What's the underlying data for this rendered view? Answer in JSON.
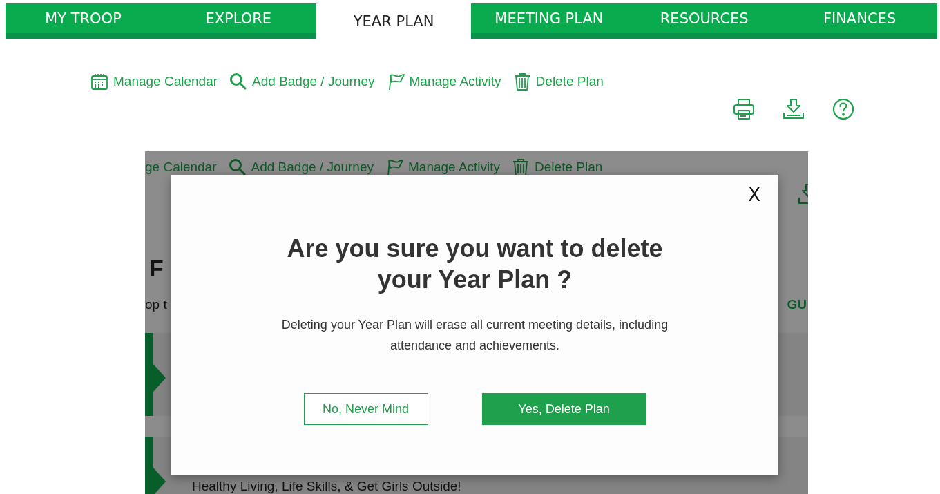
{
  "nav": {
    "tabs": [
      {
        "label": "MY TROOP",
        "selected": false
      },
      {
        "label": "EXPLORE",
        "selected": false
      },
      {
        "label": "YEAR PLAN",
        "selected": true
      },
      {
        "label": "MEETING PLAN",
        "selected": false
      },
      {
        "label": "RESOURCES",
        "selected": false
      },
      {
        "label": "FINANCES",
        "selected": false
      }
    ]
  },
  "toolbar": {
    "actions": [
      {
        "kind": "calendar",
        "label": "Manage Calendar"
      },
      {
        "kind": "search",
        "label": "Add Badge / Journey"
      },
      {
        "kind": "flag",
        "label": "Manage Activity"
      },
      {
        "kind": "trash",
        "label": "Delete Plan"
      }
    ]
  },
  "background_page": {
    "actions": [
      {
        "kind": "cut",
        "label": "ge Calendar"
      },
      {
        "kind": "search",
        "label": "Add Badge / Journey"
      },
      {
        "kind": "flag",
        "label": "Manage Activity"
      },
      {
        "kind": "trash",
        "label": "Delete Plan"
      }
    ],
    "heading": "F",
    "subtitle": "op t",
    "link": "GU",
    "item_text": "Healthy Living, Life Skills, & Get Girls Outside!"
  },
  "modal": {
    "close": "X",
    "title": "Are you sure you want to delete your Year Plan ?",
    "message": "Deleting your Year Plan will erase all current meeting details, including attendance and achievements.",
    "buttons": [
      {
        "kind": "secondary",
        "label": "No, Never Mind"
      },
      {
        "kind": "primary",
        "label": "Yes, Delete Plan"
      }
    ]
  }
}
